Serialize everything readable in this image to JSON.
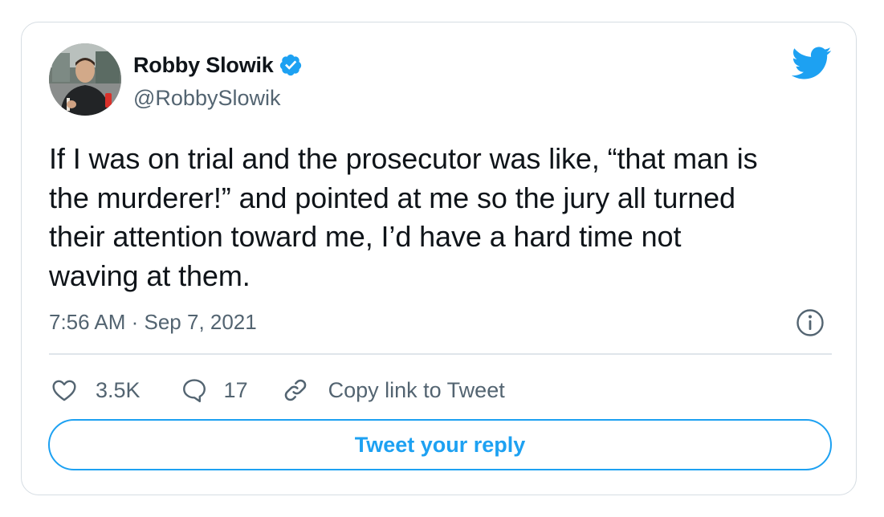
{
  "author": {
    "display_name": "Robby Slowik",
    "handle": "@RobbySlowik",
    "verified": true
  },
  "tweet": {
    "text": "If I was on trial and the prosecutor was like, “that man is\nthe murderer!” and pointed at me so the jury all turned\ntheir attention toward me, I’d have a hard time not\nwaving at them.",
    "timestamp": "7:56 AM · Sep 7, 2021"
  },
  "actions": {
    "likes": "3.5K",
    "replies": "17",
    "copy_link_label": "Copy link to Tweet"
  },
  "reply_button_label": "Tweet your reply",
  "icons": {
    "brand": "twitter-bird-icon",
    "verified": "verified-badge-icon",
    "info": "info-icon",
    "like": "heart-icon",
    "reply": "speech-bubble-icon",
    "copy_link": "link-icon"
  },
  "colors": {
    "accent": "#1da1f2",
    "text_primary": "#0f1419",
    "text_secondary": "#536471",
    "border": "#d6dde3"
  }
}
